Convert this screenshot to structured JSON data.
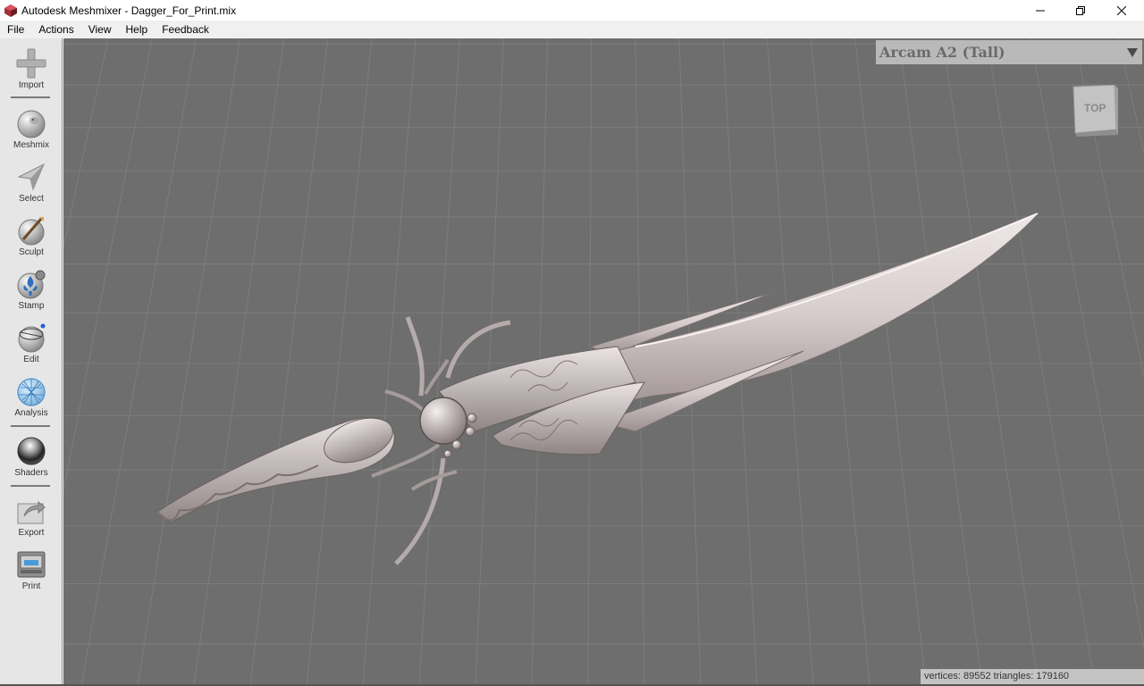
{
  "window": {
    "title": "Autodesk Meshmixer - Dagger_For_Print.mix"
  },
  "menu": [
    "File",
    "Actions",
    "View",
    "Help",
    "Feedback"
  ],
  "toolbar": {
    "import": "Import",
    "meshmix": "Meshmix",
    "select": "Select",
    "sculpt": "Sculpt",
    "stamp": "Stamp",
    "edit": "Edit",
    "analysis": "Analysis",
    "shaders": "Shaders",
    "export": "Export",
    "print": "Print"
  },
  "printer": {
    "selected": "Arcam A2 (Tall)"
  },
  "viewcube": {
    "face": "TOP"
  },
  "status": {
    "text": "vertices: 89552 triangles: 179160"
  },
  "colors": {
    "viewport": "#6e6e6e",
    "grid": "#7d7d7d",
    "model": "#c9bebe"
  }
}
